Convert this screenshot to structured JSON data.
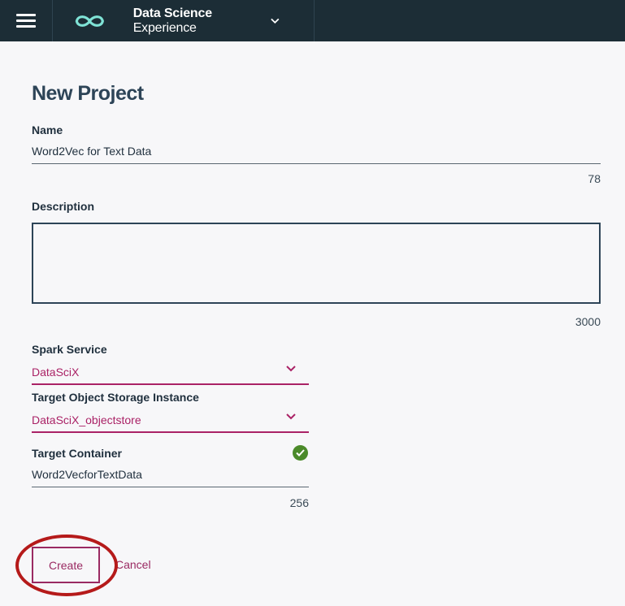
{
  "topbar": {
    "brand_bold": "Data Science",
    "brand_rest": " Experience"
  },
  "page": {
    "title": "New Project"
  },
  "form": {
    "name": {
      "label": "Name",
      "value": "Word2Vec for Text Data",
      "counter": "78"
    },
    "description": {
      "label": "Description",
      "value": "",
      "counter": "3000"
    },
    "spark_service": {
      "label": "Spark Service",
      "selected": "DataSciX"
    },
    "object_storage": {
      "label": "Target Object Storage Instance",
      "selected": "DataSciX_objectstore"
    },
    "container": {
      "label": "Target Container",
      "value": "Word2VecforTextData",
      "counter": "256",
      "status_icon": "check-circle-icon"
    }
  },
  "actions": {
    "create_label": "Create",
    "cancel_label": "Cancel"
  },
  "colors": {
    "topbar": "#1c2d36",
    "accent": "#aa2266",
    "logo": "#7fe3d6",
    "success": "#4b8a2a",
    "annotation": "#b51a1a"
  }
}
